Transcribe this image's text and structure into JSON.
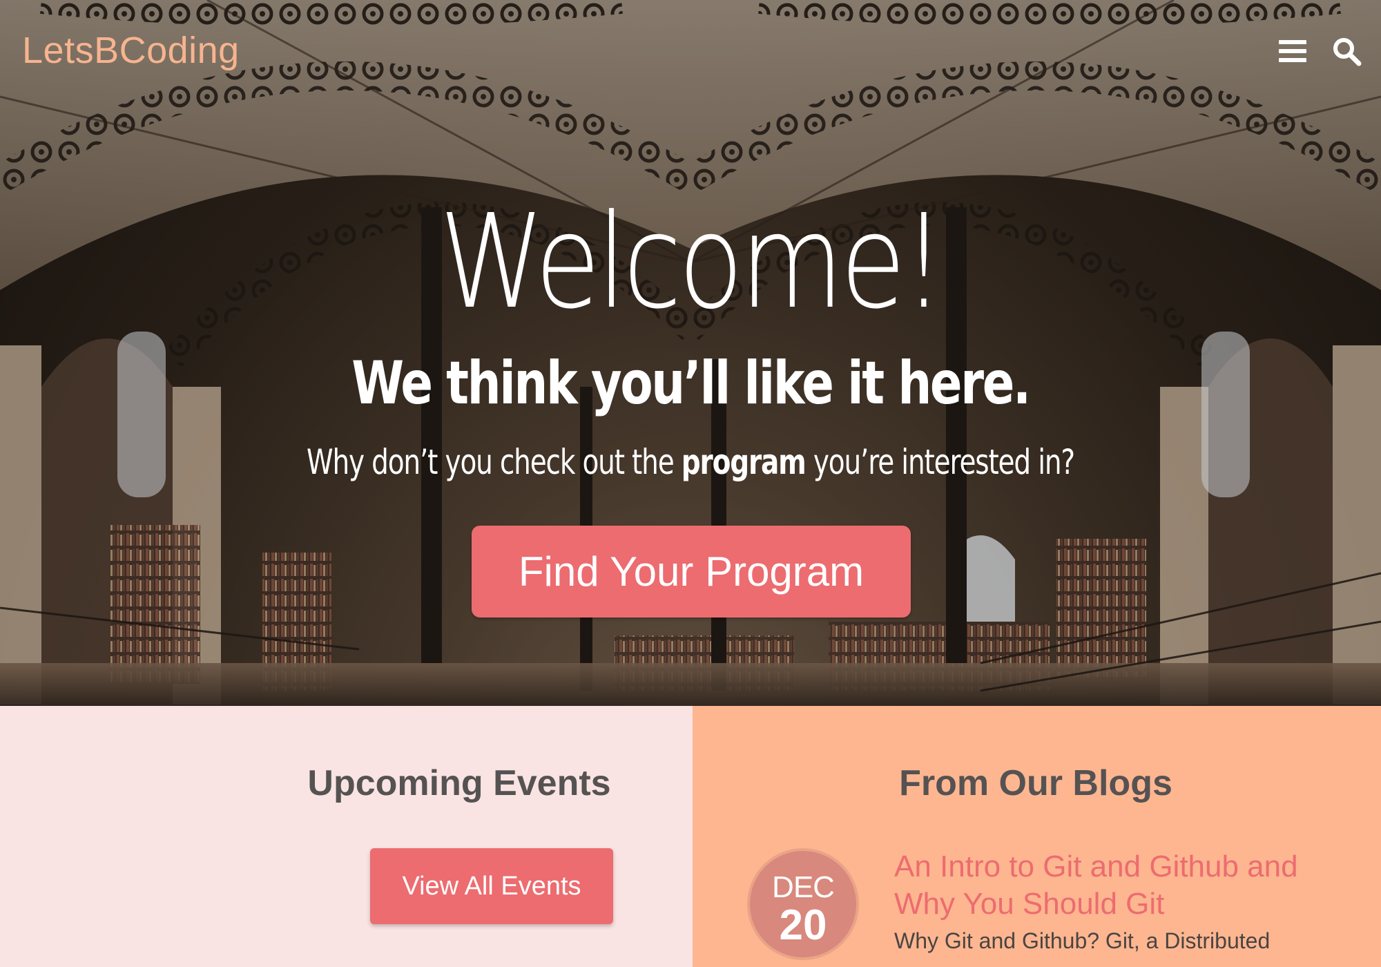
{
  "brand": {
    "name": "LetsBCoding"
  },
  "nav": {
    "menu_icon": "hamburger-menu-icon",
    "search_icon": "search-icon"
  },
  "hero": {
    "title": "Welcome!",
    "tagline": "We think you’ll like it here.",
    "subtitle_before": "Why don’t you check out the ",
    "subtitle_bold": "program",
    "subtitle_after": " you’re interested in?",
    "cta_label": "Find Your Program"
  },
  "events": {
    "title": "Upcoming Events",
    "button_label": "View All Events"
  },
  "blogs": {
    "title": "From Our Blogs",
    "post": {
      "month": "DEC",
      "day": "20",
      "title": "An Intro to Git and Github and Why You Should Git",
      "excerpt": "Why Git and Github? Git, a Distributed"
    }
  },
  "colors": {
    "accent": "#ec6c70",
    "logo": "#f7b48f",
    "events_bg": "#fae3e3",
    "blogs_bg": "#fdb690",
    "badge": "#d8887c"
  }
}
